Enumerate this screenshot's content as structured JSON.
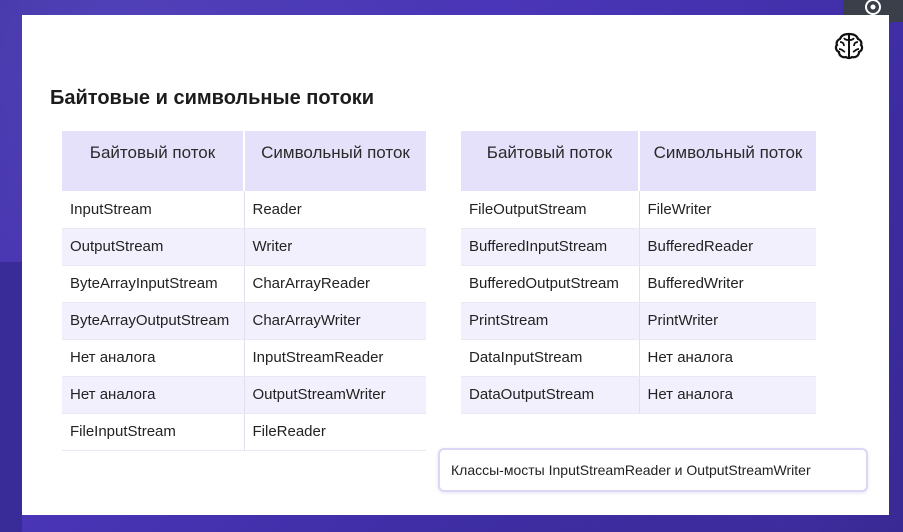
{
  "slide": {
    "title": "Байтовые и символьные потоки",
    "accent_color": "#e6e1fb",
    "background_color": "#3f2ea6",
    "logo_icon": "brain-logo-icon"
  },
  "left_table": {
    "headers": [
      "Байтовый поток",
      "Символьный поток"
    ],
    "rows": [
      [
        "InputStream",
        "Reader"
      ],
      [
        "OutputStream",
        "Writer"
      ],
      [
        "ByteArrayInputStream",
        "CharArrayReader"
      ],
      [
        "ByteArrayOutputStream",
        "CharArrayWriter"
      ],
      [
        "Нет аналога",
        "InputStreamReader"
      ],
      [
        "Нет аналога",
        "OutputStreamWriter"
      ],
      [
        "FileInputStream",
        "FileReader"
      ]
    ]
  },
  "right_table": {
    "headers": [
      "Байтовый поток",
      "Символьный поток"
    ],
    "rows": [
      [
        "FileOutputStream",
        "FileWriter"
      ],
      [
        "BufferedInputStream",
        "BufferedReader"
      ],
      [
        "BufferedOutputStream",
        "BufferedWriter"
      ],
      [
        "PrintStream",
        "PrintWriter"
      ],
      [
        "DataInputStream",
        "Нет аналога"
      ],
      [
        "DataOutputStream",
        "Нет аналога"
      ]
    ]
  },
  "note": {
    "text": "Классы-мосты InputStreamReader и OutputStreamWriter"
  }
}
